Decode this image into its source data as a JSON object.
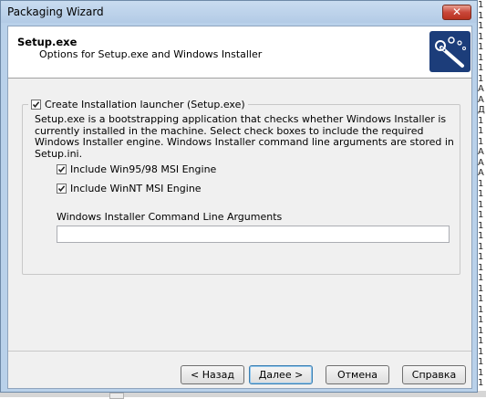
{
  "window": {
    "title": "Packaging Wizard",
    "close_symbol": "✕"
  },
  "header": {
    "title": "Setup.exe",
    "subtitle": "Options for Setup.exe and Windows Installer",
    "logo_icon": "magic-wand-icon"
  },
  "launcher_group": {
    "label": "Create Installation launcher (Setup.exe)",
    "checked": true,
    "description": "Setup.exe is a bootstrapping application that checks whether Windows Installer is currently installed in the machine. Select check boxes to include the required Windows Installer engine. Windows Installer command line arguments are stored in Setup.ini.",
    "options": [
      {
        "label": "Include Win95/98 MSI Engine",
        "checked": true
      },
      {
        "label": "Include WinNT MSI Engine",
        "checked": true
      }
    ],
    "args_label": "Windows Installer Command Line Arguments",
    "args_value": ""
  },
  "buttons": {
    "back": "< Назад",
    "next": "Далее >",
    "cancel": "Отмена",
    "help": "Справка"
  },
  "background_edge_text": [
    "1",
    "1",
    "1",
    "1",
    "1",
    "1",
    "1",
    "1",
    "А",
    "А",
    "Д",
    "1",
    "1",
    "1",
    "А",
    "А",
    "А",
    "1",
    "1",
    "1",
    "1",
    "1",
    "1",
    "1",
    "1",
    "1",
    "1",
    "1",
    "1",
    "1",
    "1",
    "1",
    "1",
    "1",
    "1",
    "1",
    "1"
  ]
}
